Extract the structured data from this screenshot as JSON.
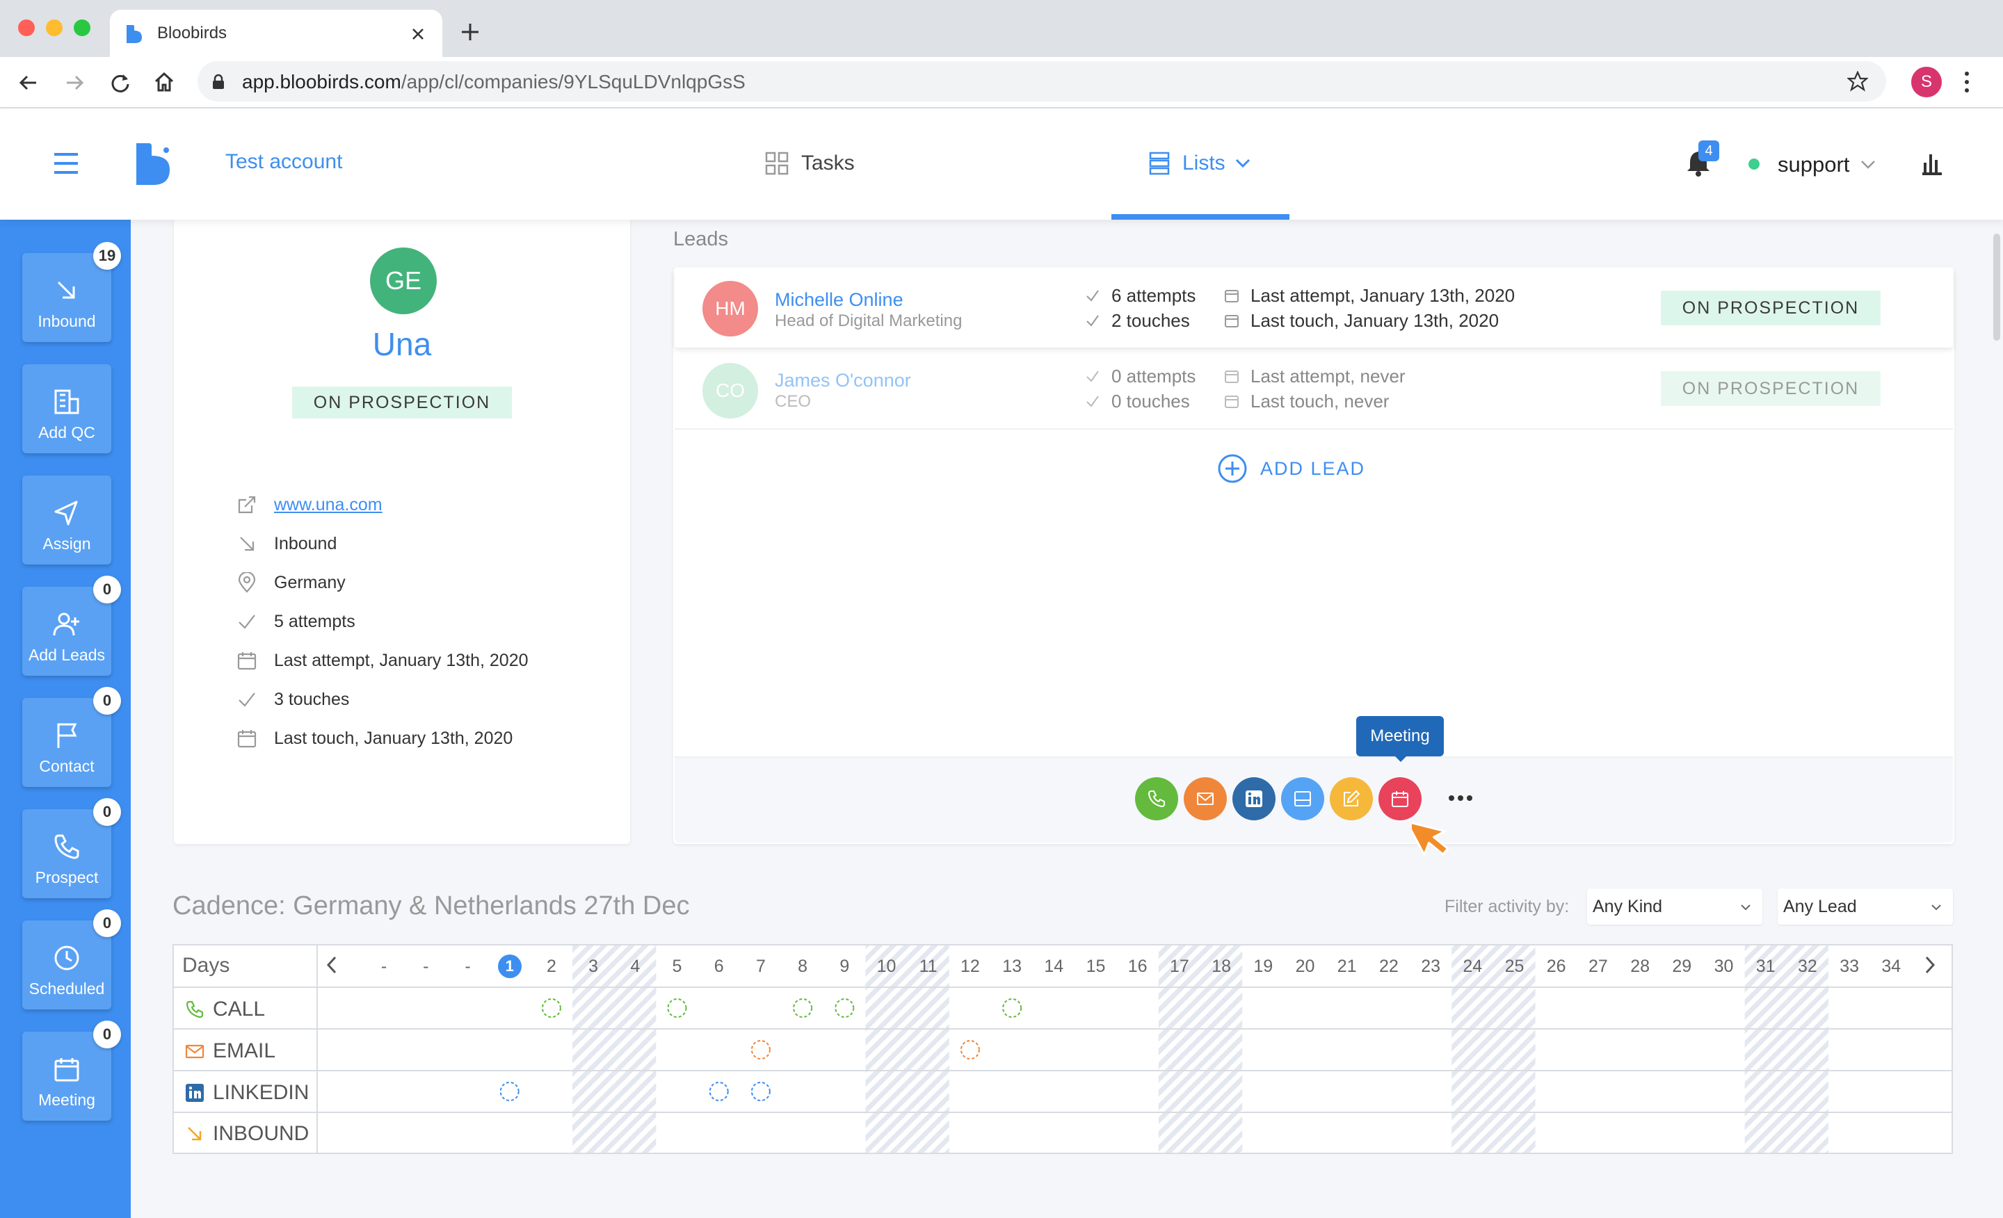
{
  "browser": {
    "tab_title": "Bloobirds",
    "url_host": "app.bloobirds.com",
    "url_path": "/app/cl/companies/9YLSquLDVnlqpGsS",
    "profile_initial": "S"
  },
  "header": {
    "account": "Test account",
    "tasks": "Tasks",
    "lists": "Lists",
    "notifications": "4",
    "user": "support"
  },
  "sidebar": {
    "items": [
      {
        "label": "Inbound",
        "badge": "19"
      },
      {
        "label": "Add QC"
      },
      {
        "label": "Assign"
      },
      {
        "label": "Add Leads",
        "badge": "0"
      },
      {
        "label": "Contact",
        "badge": "0"
      },
      {
        "label": "Prospect",
        "badge": "0"
      },
      {
        "label": "Scheduled",
        "badge": "0"
      },
      {
        "label": "Meeting",
        "badge": "0"
      }
    ]
  },
  "company": {
    "initials": "GE",
    "name": "Una",
    "status": "ON PROSPECTION",
    "website": "www.una.com",
    "source": "Inbound",
    "country": "Germany",
    "attempts": "5 attempts",
    "last_attempt": "Last attempt, January 13th, 2020",
    "touches": "3 touches",
    "last_touch": "Last touch, January 13th, 2020"
  },
  "leads": {
    "title": "Leads",
    "rows": [
      {
        "initials": "HM",
        "name": "Michelle Online",
        "role": "Head of Digital Marketing",
        "attempts": "6 attempts",
        "touches": "2 touches",
        "last_attempt": "Last attempt, January 13th, 2020",
        "last_touch": "Last touch, January 13th, 2020",
        "status": "ON PROSPECTION"
      },
      {
        "initials": "CO",
        "name": "James O'connor",
        "role": "CEO",
        "attempts": "0 attempts",
        "touches": "0 touches",
        "last_attempt": "Last attempt, never",
        "last_touch": "Last touch, never",
        "status": "ON PROSPECTION"
      }
    ],
    "add_lead": "ADD LEAD",
    "tooltip": "Meeting",
    "actions": [
      {
        "icon": "phone-icon",
        "color": "#63ba3c"
      },
      {
        "icon": "mail-icon",
        "color": "#f0863a"
      },
      {
        "icon": "linkedin-icon",
        "color": "#2e6ba8"
      },
      {
        "icon": "window-icon",
        "color": "#55a3f5"
      },
      {
        "icon": "edit-icon",
        "color": "#f5b83a"
      },
      {
        "icon": "calendar-icon",
        "color": "#e8435b"
      }
    ]
  },
  "cadence": {
    "title": "Cadence: Germany & Netherlands 27th Dec",
    "filter_label": "Filter activity by:",
    "filter_kind": "Any Kind",
    "filter_lead": "Any Lead",
    "days_label": "Days",
    "days": [
      "-",
      "-",
      "-",
      "1",
      "2",
      "3",
      "4",
      "5",
      "6",
      "7",
      "8",
      "9",
      "10",
      "11",
      "12",
      "13",
      "14",
      "15",
      "16",
      "17",
      "18",
      "19",
      "20",
      "21",
      "22",
      "23",
      "24",
      "25",
      "26",
      "27",
      "28",
      "29",
      "30",
      "31",
      "32",
      "33",
      "34"
    ],
    "weekend_days": [
      "3",
      "4",
      "10",
      "11",
      "17",
      "18",
      "24",
      "25",
      "31",
      "32"
    ],
    "current_day": "1",
    "rows": [
      {
        "label": "CALL",
        "icon": "phone-icon",
        "color": "#63ba3c",
        "marks": [
          "2",
          "5",
          "8",
          "9",
          "13"
        ]
      },
      {
        "label": "EMAIL",
        "icon": "mail-icon",
        "color": "#f0863a",
        "marks": [
          "7",
          "12"
        ]
      },
      {
        "label": "LINKEDIN",
        "icon": "linkedin-icon",
        "color": "#3d8ef0",
        "marks": [
          "1",
          "6",
          "7"
        ]
      },
      {
        "label": "INBOUND",
        "icon": "inbound-arrow-icon",
        "color": "#f5a623",
        "marks": []
      }
    ]
  }
}
